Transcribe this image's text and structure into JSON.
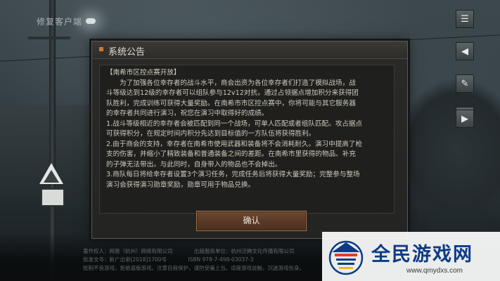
{
  "app": {
    "title": "修复客户端"
  },
  "dialog": {
    "title": "系统公告",
    "lines": [
      "【南希市区控点赛开放】",
      "为了加强各位幸存者的战斗水平，商会出资为各位幸存者们打造了模拟战场，战",
      "斗等级达到12级的幸存者可以组队参与12v12对抗，通过占领据点增加积分来获得团",
      "队胜利，完成训练可获得大量奖励。在南希市市区控点赛中，你将可能与其它服务器",
      "的幸存者共同进行演习，祝您在演习中取得好的成绩。",
      "1.战斗等级相近的幸存者会被匹配到同一个战场，可单人匹配或者组队匹配。攻占据点",
      "可获得积分，在规定时间内积分先达到目标值的一方队伍将获得胜利。",
      "2.由于商会的支持，幸存者在南希市使用武器和装备将不会消耗耐久。演习中提高了枪",
      "支的伤害，并缩小了精致装备和普通装备之间的差距。在南希市里获得的物品、补充",
      "的子弹无法带出。与此同时，自身带入的物品也不会掉出。",
      "3.商队每日将给幸存者设置3个演习任务，完成任务后将获得大量奖励；完整参与整场",
      "演习会获得演习勋章奖励，勋章可用于物品兑换。"
    ],
    "confirm_label": "确认"
  },
  "legal": {
    "line1": [
      "著作权人：网易（杭州）网络有限公司",
      "出版服务单位：杭州泛腾文化传播有限公司"
    ],
    "line2": [
      "批准文号：新广出审[2018]1700号",
      "ISBN 978-7-498-03037-3"
    ],
    "line3": [
      "抵制不良游戏，拒绝盗版游戏。注意自我保护，谨防受骗上当。适度游戏益脑，沉迷游戏伤身。"
    ]
  },
  "watermark": {
    "name": "全民游戏网",
    "url": "www.qmydxs.com"
  },
  "colors": {
    "accent": "#c97a38",
    "button": "#5a3a27",
    "watermark_blue": "#0c3b86"
  }
}
